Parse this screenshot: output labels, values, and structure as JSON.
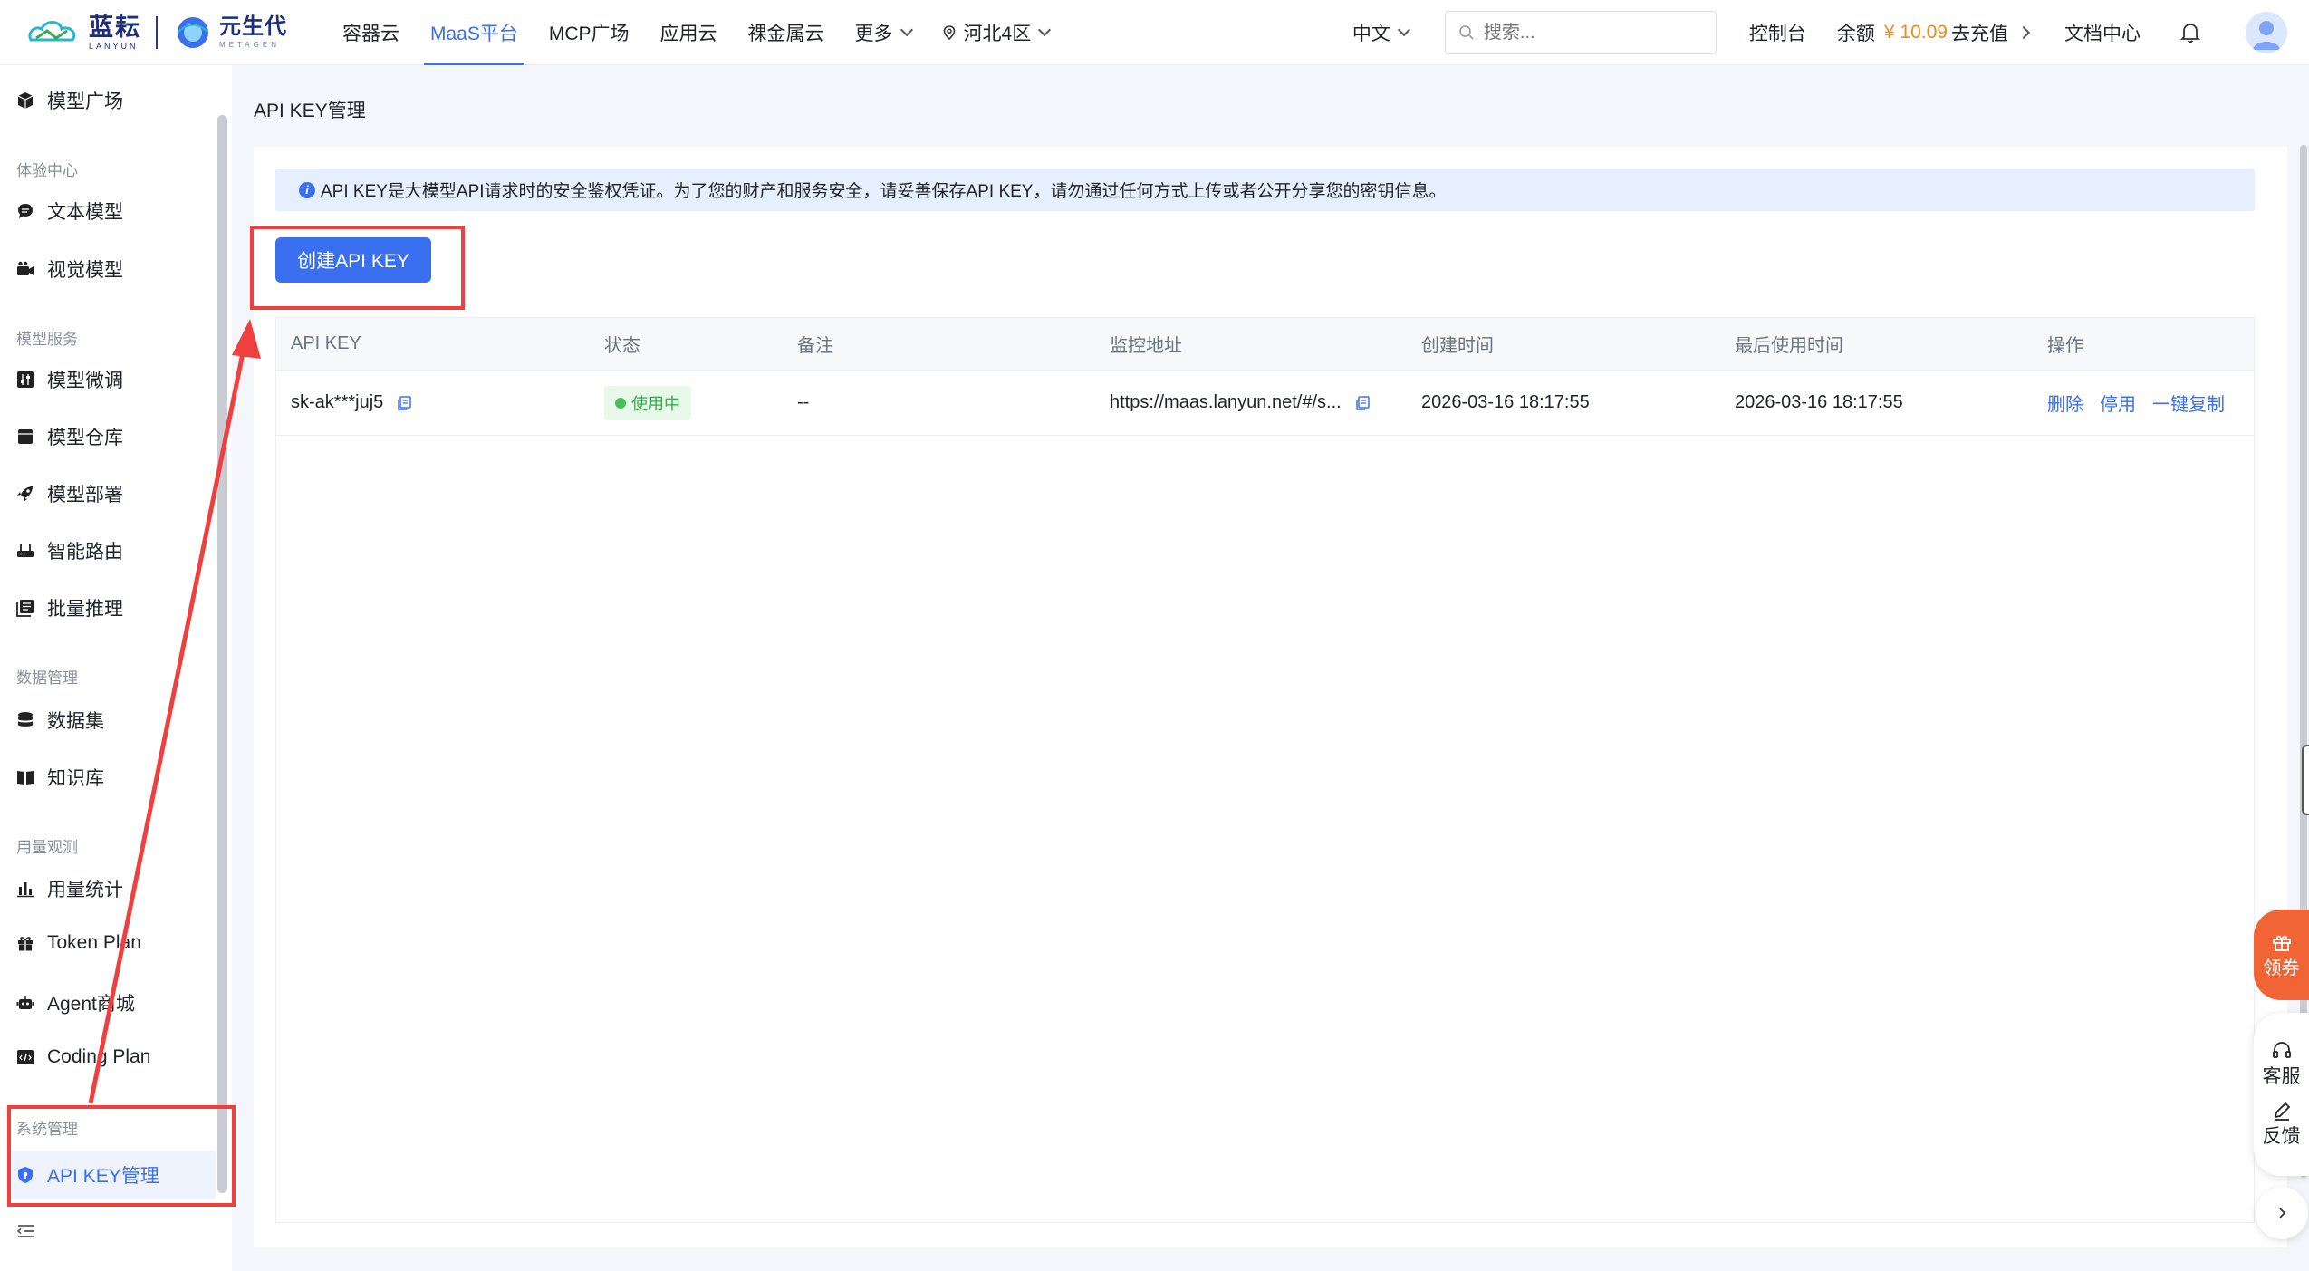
{
  "header": {
    "logo1_cn": "蓝耘",
    "logo1_en": "LANYUN",
    "logo2_cn": "元生代",
    "logo2_en": "METAGEN",
    "nav": [
      {
        "label": "容器云"
      },
      {
        "label": "MaaS平台"
      },
      {
        "label": "MCP广场"
      },
      {
        "label": "应用云"
      },
      {
        "label": "裸金属云"
      },
      {
        "label": "更多"
      },
      {
        "label": "河北4区"
      }
    ],
    "lang": "中文",
    "search_placeholder": "搜索...",
    "console": "控制台",
    "balance_label": "余额",
    "balance_amount": "¥ 10.09",
    "recharge": "去充值",
    "docs": "文档中心"
  },
  "sidebar": {
    "model_plaza": "模型广场",
    "group_experience": "体验中心",
    "text_model": "文本模型",
    "vision_model": "视觉模型",
    "group_model_service": "模型服务",
    "finetune": "模型微调",
    "repo": "模型仓库",
    "deploy": "模型部署",
    "routing": "智能路由",
    "batch": "批量推理",
    "group_data": "数据管理",
    "dataset": "数据集",
    "knowledge": "知识库",
    "group_usage": "用量观测",
    "usage_stats": "用量统计",
    "token_plan": "Token Plan",
    "agent_mall": "Agent商城",
    "coding_plan": "Coding Plan",
    "group_system": "系统管理",
    "api_key_mgmt": "API KEY管理"
  },
  "main": {
    "page_title": "API KEY管理",
    "notice": "API KEY是大模型API请求时的安全鉴权凭证。为了您的财产和服务安全，请妥善保存API KEY，请勿通过任何方式上传或者公开分享您的密钥信息。",
    "create_button": "创建API KEY",
    "table": {
      "columns": [
        "API KEY",
        "状态",
        "备注",
        "监控地址",
        "创建时间",
        "最后使用时间",
        "操作"
      ],
      "rows": [
        {
          "api_key": "sk-ak***juj5",
          "status": "使用中",
          "remark": "--",
          "monitor_url": "https://maas.lanyun.net/#/s...",
          "created": "2026-03-16 18:17:55",
          "last_used": "2026-03-16 18:17:55",
          "op_delete": "删除",
          "op_disable": "停用",
          "op_copy": "一键复制"
        }
      ]
    }
  },
  "float": {
    "coupon": "领券",
    "service": "客服",
    "feedback": "反馈"
  },
  "colors": {
    "accent": "#3a6ff0",
    "balance": "#f08a1c",
    "status_green": "#3aa850",
    "annotation_red": "#ef4040",
    "coupon_orange": "#f06436"
  }
}
